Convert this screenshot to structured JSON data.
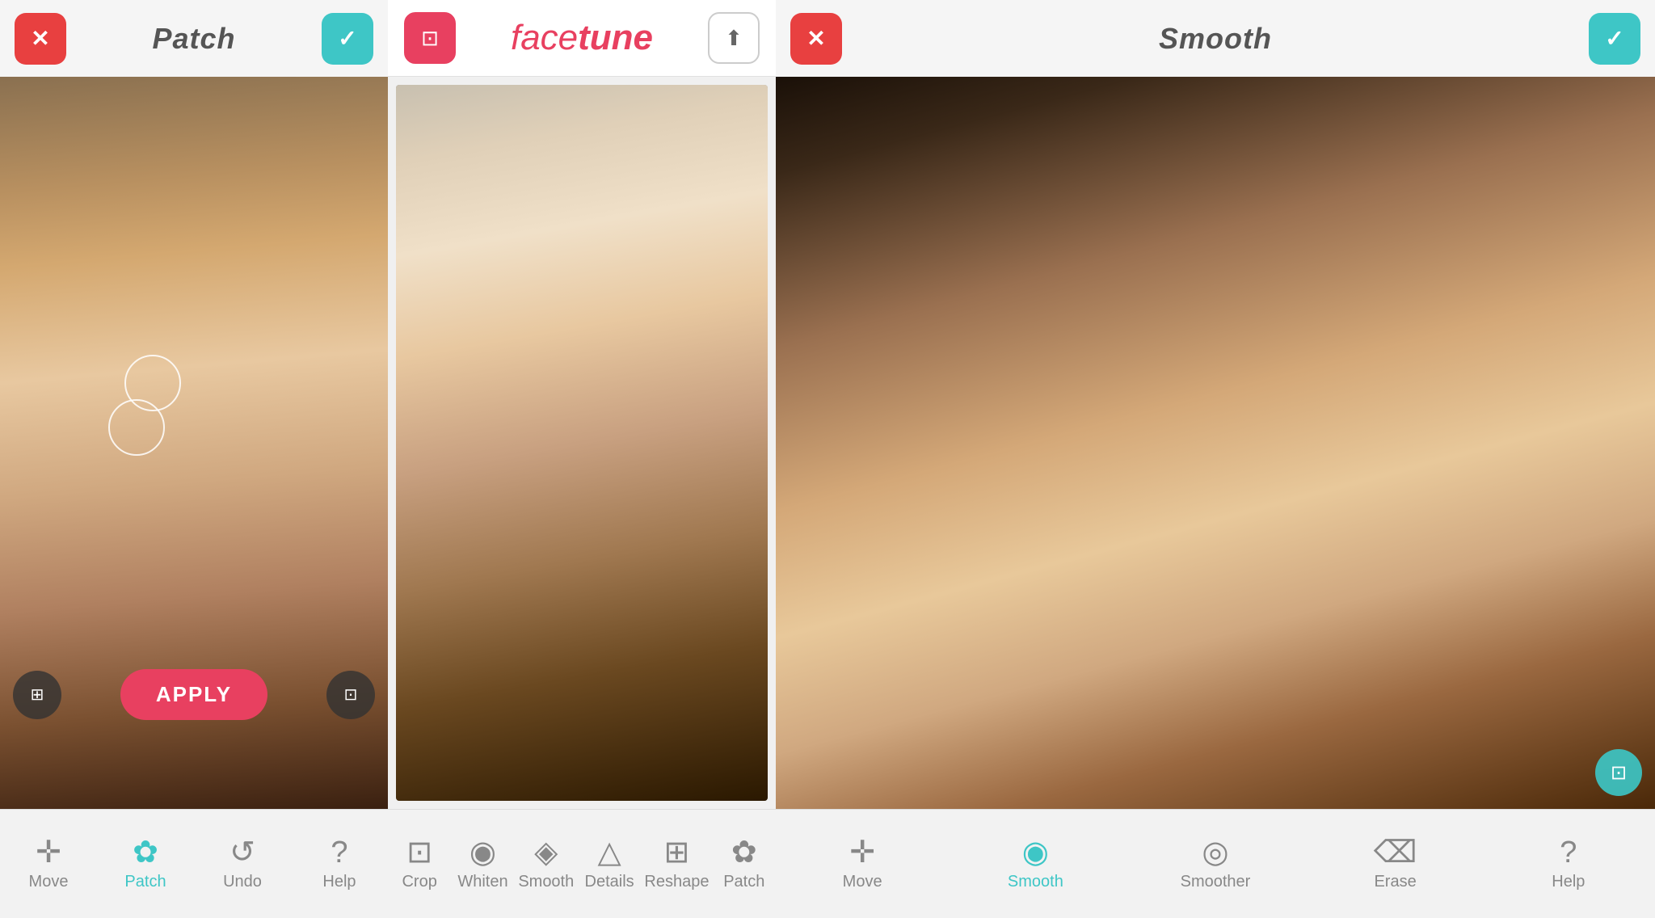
{
  "left_panel": {
    "title": "Patch",
    "cancel_label": "✕",
    "confirm_label": "✓",
    "apply_label": "APPLY",
    "toolbar": {
      "items": [
        {
          "id": "move",
          "label": "Move",
          "icon": "✛",
          "active": false
        },
        {
          "id": "patch",
          "label": "Patch",
          "icon": "⚙",
          "active": true
        },
        {
          "id": "undo",
          "label": "Undo",
          "icon": "↺",
          "active": false
        },
        {
          "id": "help",
          "label": "Help",
          "icon": "?",
          "active": false
        }
      ]
    }
  },
  "center_panel": {
    "logo_text": "facetune",
    "toolbar": {
      "items": [
        {
          "id": "crop",
          "label": "Crop",
          "icon": "⊡",
          "active": false
        },
        {
          "id": "whiten",
          "label": "Whiten",
          "icon": "◉",
          "active": false
        },
        {
          "id": "smooth",
          "label": "Smooth",
          "icon": "◈",
          "active": false
        },
        {
          "id": "details",
          "label": "Details",
          "icon": "△",
          "active": false
        },
        {
          "id": "reshape",
          "label": "Reshape",
          "icon": "⊞",
          "active": false
        },
        {
          "id": "patch",
          "label": "Patch",
          "icon": "⊛",
          "active": false
        }
      ]
    }
  },
  "right_panel": {
    "title": "Smooth",
    "cancel_label": "✕",
    "confirm_label": "✓",
    "toolbar": {
      "items": [
        {
          "id": "move",
          "label": "Move",
          "icon": "✛",
          "active": false
        },
        {
          "id": "smooth",
          "label": "Smooth",
          "icon": "◉",
          "active": true
        },
        {
          "id": "smoother",
          "label": "Smoother",
          "icon": "◎",
          "active": false
        },
        {
          "id": "erase",
          "label": "Erase",
          "icon": "⌫",
          "active": false
        },
        {
          "id": "help",
          "label": "Help",
          "icon": "?",
          "active": false
        }
      ]
    }
  }
}
